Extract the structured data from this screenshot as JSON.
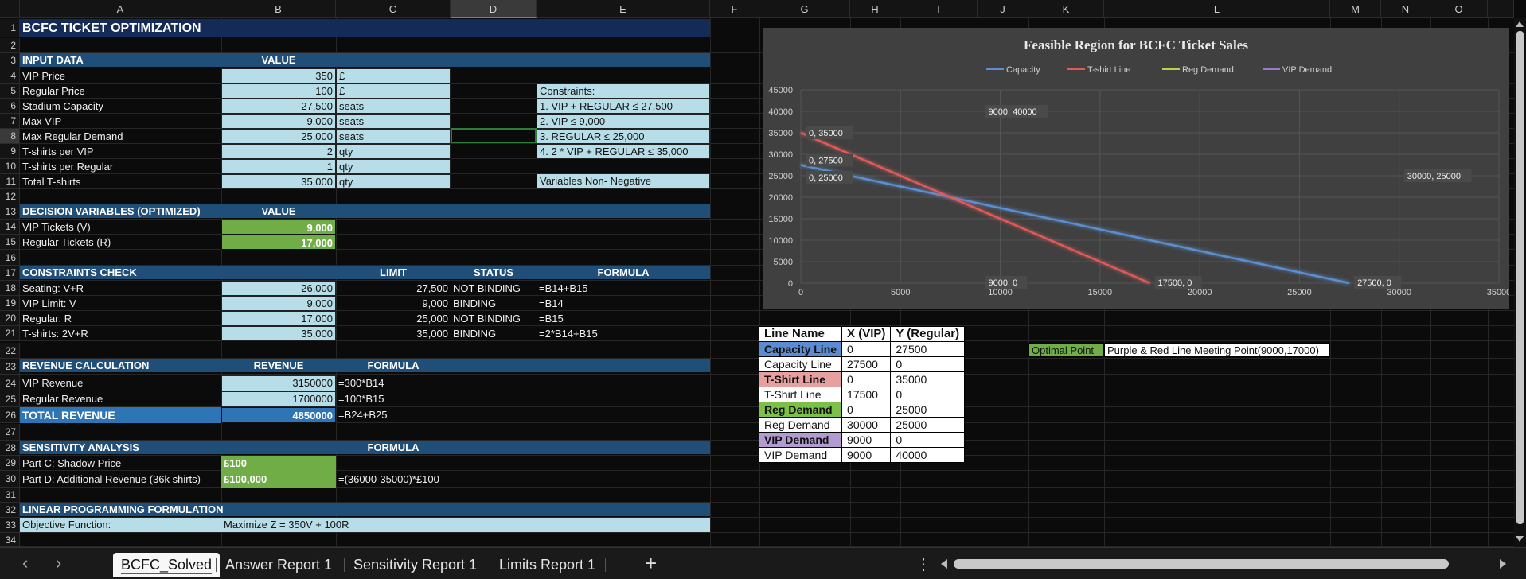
{
  "columns": [
    "A",
    "B",
    "C",
    "D",
    "E",
    "F",
    "G",
    "H",
    "I",
    "J",
    "K",
    "L",
    "M",
    "N",
    "O"
  ],
  "rows": [
    "1",
    "2",
    "3",
    "4",
    "5",
    "6",
    "7",
    "8",
    "9",
    "10",
    "11",
    "12",
    "13",
    "14",
    "15",
    "16",
    "17",
    "18",
    "19",
    "20",
    "21",
    "22",
    "23",
    "24",
    "25",
    "26",
    "27",
    "28",
    "29",
    "30",
    "31",
    "32",
    "33",
    "34"
  ],
  "cells": {
    "title": "BCFC TICKET OPTIMIZATION",
    "input_hdr": "INPUT DATA",
    "input_val_hdr": "VALUE",
    "inputs": [
      {
        "label": "VIP Price",
        "value": "350",
        "unit": "£"
      },
      {
        "label": "Regular Price",
        "value": "100",
        "unit": "£"
      },
      {
        "label": "Stadium Capacity",
        "value": "27,500",
        "unit": "seats"
      },
      {
        "label": "Max VIP",
        "value": "9,000",
        "unit": "seats"
      },
      {
        "label": "Max Regular Demand",
        "value": "25,000",
        "unit": "seats"
      },
      {
        "label": "T-shirts per VIP",
        "value": "2",
        "unit": "qty"
      },
      {
        "label": "T-shirts per Regular",
        "value": "1",
        "unit": "qty"
      },
      {
        "label": "Total T-shirts",
        "value": "35,000",
        "unit": "qty"
      }
    ],
    "constraints_title": "Constraints:",
    "constraints": [
      "1. VIP + REGULAR ≤ 27,500",
      "2. VIP ≤ 9,000",
      "3. REGULAR ≤ 25,000",
      "4. 2 * VIP + REGULAR ≤ 35,000"
    ],
    "nonneg": "Variables Non- Negative",
    "dec_hdr": "DECISION VARIABLES (OPTIMIZED)",
    "dec_val_hdr": "VALUE",
    "decisions": [
      {
        "label": "VIP Tickets (V)",
        "value": "9,000"
      },
      {
        "label": "Regular Tickets (R)",
        "value": "17,000"
      }
    ],
    "cc_hdr": "CONSTRAINTS CHECK",
    "cc_limit": "LIMIT",
    "cc_status": "STATUS",
    "cc_formula": "FORMULA",
    "checks": [
      {
        "label": "Seating: V+R",
        "value": "26,000",
        "limit": "27,500",
        "status": "NOT BINDING",
        "formula": "=B14+B15"
      },
      {
        "label": "VIP Limit: V",
        "value": "9,000",
        "limit": "9,000",
        "status": "BINDING",
        "formula": "=B14"
      },
      {
        "label": "Regular: R",
        "value": "17,000",
        "limit": "25,000",
        "status": "NOT BINDING",
        "formula": "=B15"
      },
      {
        "label": "T-shirts: 2V+R",
        "value": "35,000",
        "limit": "35,000",
        "status": "BINDING",
        "formula": "=2*B14+B15"
      }
    ],
    "rev_hdr": "REVENUE CALCULATION",
    "rev_rev": "REVENUE",
    "rev_formula": "FORMULA",
    "revenue": [
      {
        "label": "VIP Revenue",
        "value": "3150000",
        "formula": "=300*B14"
      },
      {
        "label": "Regular Revenue",
        "value": "1700000",
        "formula": "=100*B15"
      }
    ],
    "total_label": "TOTAL REVENUE",
    "total_value": "4850000",
    "total_formula": "=B24+B25",
    "sens_hdr": "SENSITIVITY ANALYSIS",
    "sens_formula": "FORMULA",
    "sens": [
      {
        "label": "Part C: Shadow Price",
        "value": "£100",
        "formula": ""
      },
      {
        "label": "Part D: Additional Revenue (36k shirts)",
        "value": "£100,000",
        "formula": "=(36000-35000)*£100"
      }
    ],
    "lp_hdr": "LINEAR PROGRAMMING FORMULATION",
    "obj_label": "Objective Function:",
    "obj_value": "Maximize Z = 350V + 100R",
    "optimal_label": "Optimal Point",
    "optimal_value": "Purple & Red Line Meeting Point(9000,17000)"
  },
  "line_table": {
    "headers": [
      "Line Name",
      "X (VIP)",
      "Y (Regular)"
    ],
    "rows": [
      {
        "name": "Capacity Line",
        "x": "0",
        "y": "27500",
        "hl": "#5b8bd0"
      },
      {
        "name": "Capacity Line",
        "x": "27500",
        "y": "0",
        "hl": ""
      },
      {
        "name": "T-Shirt Line",
        "x": "0",
        "y": "35000",
        "hl": "#e6a0a0"
      },
      {
        "name": "T-Shirt Line",
        "x": "17500",
        "y": "0",
        "hl": ""
      },
      {
        "name": "Reg Demand",
        "x": "0",
        "y": "25000",
        "hl": "#7cc04a"
      },
      {
        "name": "Reg Demand",
        "x": "30000",
        "y": "25000",
        "hl": ""
      },
      {
        "name": "VIP Demand",
        "x": "9000",
        "y": "0",
        "hl": "#b39bd1"
      },
      {
        "name": "VIP Demand",
        "x": "9000",
        "y": "40000",
        "hl": ""
      }
    ]
  },
  "chart_data": {
    "type": "scatter",
    "title": "Feasible Region for BCFC Ticket Sales",
    "xlim": [
      0,
      35000
    ],
    "ylim": [
      0,
      45000
    ],
    "xticks": [
      0,
      5000,
      10000,
      15000,
      20000,
      25000,
      30000,
      35000
    ],
    "yticks": [
      0,
      5000,
      10000,
      15000,
      20000,
      25000,
      30000,
      35000,
      40000,
      45000
    ],
    "grid": true,
    "legend_position": "top",
    "series": [
      {
        "name": "Capacity",
        "color": "#5b8fd1",
        "points": [
          [
            0,
            27500
          ],
          [
            27500,
            0
          ]
        ]
      },
      {
        "name": "T-shirt Line",
        "color": "#e05a5a",
        "points": [
          [
            0,
            35000
          ],
          [
            17500,
            0
          ]
        ]
      },
      {
        "name": "Reg Demand",
        "color": "#b6d24a",
        "points": [
          [
            0,
            25000
          ],
          [
            30000,
            25000
          ]
        ]
      },
      {
        "name": "VIP Demand",
        "color": "#9b78c8",
        "points": [
          [
            9000,
            0
          ],
          [
            9000,
            40000
          ]
        ]
      }
    ],
    "data_labels": [
      {
        "text": "9000, 40000",
        "x": 9000,
        "y": 40000
      },
      {
        "text": "0, 35000",
        "x": 0,
        "y": 35000
      },
      {
        "text": "0, 27500",
        "x": 0,
        "y": 27500
      },
      {
        "text": "0, 25000",
        "x": 0,
        "y": 25000
      },
      {
        "text": "30000, 25000",
        "x": 30000,
        "y": 25000
      },
      {
        "text": "9000, 0",
        "x": 9000,
        "y": 0
      },
      {
        "text": "17500, 0",
        "x": 17500,
        "y": 0
      },
      {
        "text": "27500, 0",
        "x": 27500,
        "y": 0
      }
    ]
  },
  "tabs": [
    "BCFC_Solved",
    "Answer Report 1",
    "Sensitivity Report 1",
    "Limits Report 1"
  ],
  "active_tab": "BCFC_Solved",
  "tab_nav": {
    "prev": "‹",
    "next": "›",
    "add": "+",
    "more": "⋮"
  }
}
